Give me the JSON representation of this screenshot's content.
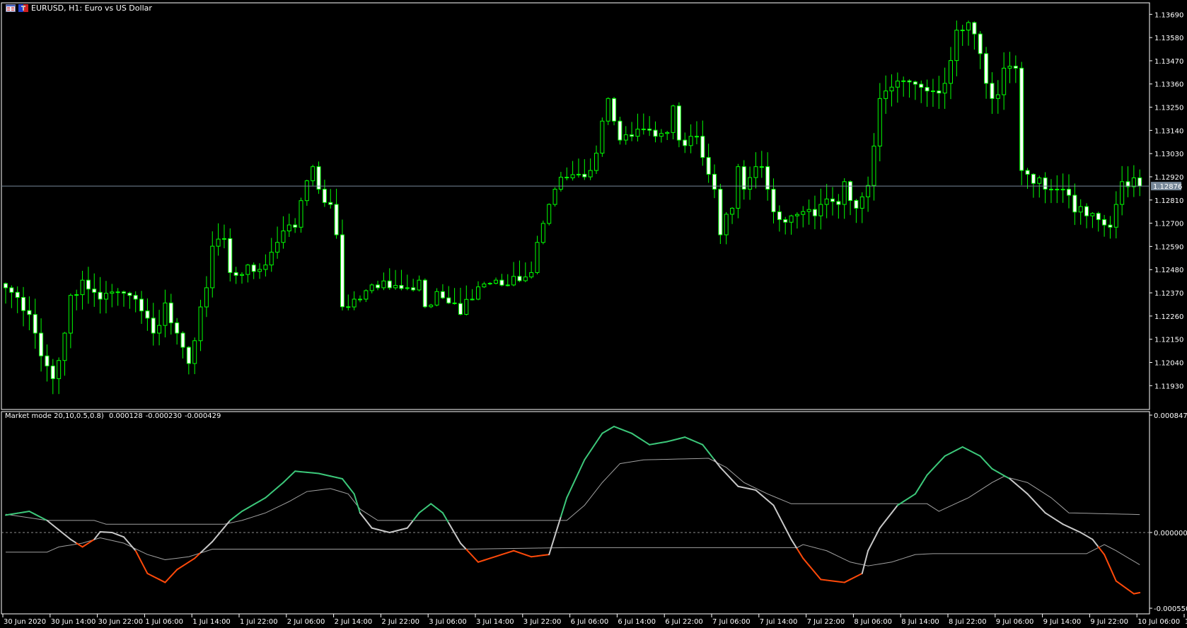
{
  "window": {
    "title": "EURUSD, H1:  Euro vs US Dollar",
    "icons": [
      "chart-window-icon",
      "symbol-icon"
    ]
  },
  "colors": {
    "background": "#000000",
    "candle_outline": "#00ff00",
    "bear_body": "#ffffff",
    "bull_body": "#000000",
    "current_price_line": "#778899",
    "axis": "#ffffff",
    "main_line_neutral": "#c8c8c8",
    "main_line_above": "#3cc87a",
    "main_line_below": "#ff4a0a",
    "bands": "#a0a0a0",
    "zero_line": "#8c8c8c"
  },
  "chart_data": [
    {
      "type": "candlestick",
      "title": "EURUSD, H1:  Euro vs US Dollar",
      "bar_count": 193,
      "ylim": [
        1.1168,
        1.1375
      ],
      "y_ticks": [
        "1.13690",
        "1.13580",
        "1.13470",
        "1.13360",
        "1.13250",
        "1.13140",
        "1.13030",
        "1.12920",
        "1.12810",
        "1.12700",
        "1.12590",
        "1.12480",
        "1.12370",
        "1.12260",
        "1.12150",
        "1.12040",
        "1.11930"
      ],
      "current_price": "1.12876",
      "close_keyframes": [
        [
          0,
          1.12394
        ],
        [
          3,
          1.12286
        ],
        [
          5,
          1.12179
        ],
        [
          6,
          1.12071
        ],
        [
          8,
          1.11963
        ],
        [
          10,
          1.12179
        ],
        [
          11,
          1.12358
        ],
        [
          13,
          1.1243
        ],
        [
          16,
          1.1234
        ],
        [
          22,
          1.1234
        ],
        [
          24,
          1.1225
        ],
        [
          25,
          1.12179
        ],
        [
          27,
          1.12322
        ],
        [
          29,
          1.12179
        ],
        [
          31,
          1.12035
        ],
        [
          32,
          1.12143
        ],
        [
          34,
          1.12394
        ],
        [
          35,
          1.12591
        ],
        [
          37,
          1.12627
        ],
        [
          38,
          1.12466
        ],
        [
          41,
          1.12502
        ],
        [
          44,
          1.12502
        ],
        [
          46,
          1.12609
        ],
        [
          49,
          1.12681
        ],
        [
          50,
          1.12807
        ],
        [
          52,
          1.12968
        ],
        [
          53,
          1.12861
        ],
        [
          55,
          1.12789
        ],
        [
          56,
          1.12645
        ],
        [
          57,
          1.12304
        ],
        [
          59,
          1.1234
        ],
        [
          60,
          1.1234
        ],
        [
          63,
          1.12394
        ],
        [
          65,
          1.12394
        ],
        [
          68,
          1.12394
        ],
        [
          70,
          1.1243
        ],
        [
          71,
          1.12304
        ],
        [
          73,
          1.12376
        ],
        [
          75,
          1.12322
        ],
        [
          77,
          1.12268
        ],
        [
          79,
          1.1234
        ],
        [
          81,
          1.12412
        ],
        [
          83,
          1.1243
        ],
        [
          86,
          1.12448
        ],
        [
          89,
          1.12466
        ],
        [
          90,
          1.12609
        ],
        [
          91,
          1.12699
        ],
        [
          92,
          1.12789
        ],
        [
          93,
          1.12861
        ],
        [
          95,
          1.12915
        ],
        [
          97,
          1.12932
        ],
        [
          99,
          1.1295
        ],
        [
          101,
          1.13184
        ],
        [
          102,
          1.13291
        ],
        [
          103,
          1.13184
        ],
        [
          104,
          1.13094
        ],
        [
          106,
          1.13112
        ],
        [
          110,
          1.13112
        ],
        [
          112,
          1.1313
        ],
        [
          113,
          1.13256
        ],
        [
          114,
          1.13094
        ],
        [
          116,
          1.13112
        ],
        [
          117,
          1.13112
        ],
        [
          119,
          1.12932
        ],
        [
          120,
          1.12861
        ],
        [
          121,
          1.12645
        ],
        [
          123,
          1.12771
        ],
        [
          124,
          1.12968
        ],
        [
          125,
          1.12861
        ],
        [
          127,
          1.12968
        ],
        [
          128,
          1.12968
        ],
        [
          129,
          1.12861
        ],
        [
          131,
          1.12717
        ],
        [
          133,
          1.12735
        ],
        [
          137,
          1.12735
        ],
        [
          138,
          1.12789
        ],
        [
          141,
          1.12789
        ],
        [
          142,
          1.12897
        ],
        [
          144,
          1.12771
        ],
        [
          145,
          1.12825
        ],
        [
          146,
          1.12879
        ],
        [
          148,
          1.13291
        ],
        [
          150,
          1.13345
        ],
        [
          157,
          1.13327
        ],
        [
          159,
          1.13363
        ],
        [
          160,
          1.13471
        ],
        [
          161,
          1.13615
        ],
        [
          163,
          1.13651
        ],
        [
          164,
          1.13597
        ],
        [
          166,
          1.13363
        ],
        [
          167,
          1.13291
        ],
        [
          168,
          1.13309
        ],
        [
          169,
          1.13435
        ],
        [
          171,
          1.13435
        ],
        [
          172,
          1.1295
        ],
        [
          173,
          1.12932
        ],
        [
          175,
          1.12915
        ],
        [
          177,
          1.12861
        ],
        [
          179,
          1.12861
        ],
        [
          181,
          1.12753
        ],
        [
          183,
          1.12735
        ],
        [
          185,
          1.12717
        ],
        [
          187,
          1.12681
        ],
        [
          188,
          1.12789
        ],
        [
          189,
          1.12897
        ],
        [
          191,
          1.12915
        ],
        [
          192,
          1.12876
        ]
      ],
      "x_ticks": [
        "30 Jun 2020",
        "30 Jun 14:00",
        "30 Jun 22:00",
        "1 Jul 06:00",
        "1 Jul 14:00",
        "1 Jul 22:00",
        "2 Jul 06:00",
        "2 Jul 14:00",
        "2 Jul 22:00",
        "3 Jul 06:00",
        "3 Jul 14:00",
        "3 Jul 22:00",
        "6 Jul 06:00",
        "6 Jul 14:00",
        "6 Jul 22:00",
        "7 Jul 06:00",
        "7 Jul 14:00",
        "7 Jul 22:00",
        "8 Jul 06:00",
        "8 Jul 14:00",
        "8 Jul 22:00",
        "9 Jul 06:00",
        "9 Jul 14:00",
        "9 Jul 22:00",
        "10 Jul 06:00",
        "10 Jul 14:00"
      ]
    },
    {
      "type": "line",
      "title": "Market mode 20,10,0.5,0.8)",
      "values_text": [
        "0.000128",
        "-0.000230",
        "-0.000429"
      ],
      "ylim": [
        -0.00055,
        0.000847
      ],
      "y_ticks": [
        "0.000847",
        "0.000000",
        "-0.000550"
      ],
      "unit_multiplier": 1e-06,
      "series": [
        {
          "name": "main",
          "keyframes": [
            [
              0,
              124
            ],
            [
              4,
              151
            ],
            [
              7,
              86
            ],
            [
              11,
              -49
            ],
            [
              13,
              -103
            ],
            [
              15,
              -49
            ],
            [
              16,
              5
            ],
            [
              18,
              0
            ],
            [
              20,
              -32
            ],
            [
              22,
              -130
            ],
            [
              24,
              -292
            ],
            [
              27,
              -356
            ],
            [
              29,
              -265
            ],
            [
              32,
              -184
            ],
            [
              35,
              -65
            ],
            [
              38,
              86
            ],
            [
              40,
              151
            ],
            [
              44,
              248
            ],
            [
              47,
              356
            ],
            [
              49,
              437
            ],
            [
              53,
              421
            ],
            [
              57,
              383
            ],
            [
              59,
              275
            ],
            [
              60,
              140
            ],
            [
              62,
              32
            ],
            [
              65,
              0
            ],
            [
              68,
              32
            ],
            [
              70,
              140
            ],
            [
              72,
              205
            ],
            [
              74,
              140
            ],
            [
              77,
              -76
            ],
            [
              80,
              -211
            ],
            [
              82,
              -184
            ],
            [
              86,
              -130
            ],
            [
              89,
              -173
            ],
            [
              92,
              -157
            ],
            [
              93,
              -22
            ],
            [
              95,
              248
            ],
            [
              98,
              518
            ],
            [
              101,
              707
            ],
            [
              103,
              756
            ],
            [
              106,
              707
            ],
            [
              109,
              626
            ],
            [
              112,
              648
            ],
            [
              115,
              680
            ],
            [
              118,
              626
            ],
            [
              121,
              464
            ],
            [
              124,
              329
            ],
            [
              127,
              302
            ],
            [
              130,
              194
            ],
            [
              133,
              -49
            ],
            [
              135,
              -184
            ],
            [
              138,
              -335
            ],
            [
              142,
              -356
            ],
            [
              145,
              -292
            ],
            [
              146,
              -130
            ],
            [
              148,
              32
            ],
            [
              151,
              194
            ],
            [
              154,
              275
            ],
            [
              156,
              410
            ],
            [
              159,
              545
            ],
            [
              162,
              610
            ],
            [
              165,
              545
            ],
            [
              167,
              454
            ],
            [
              170,
              383
            ],
            [
              173,
              275
            ],
            [
              176,
              140
            ],
            [
              179,
              59
            ],
            [
              182,
              0
            ],
            [
              184,
              -49
            ],
            [
              186,
              -157
            ],
            [
              188,
              -346
            ],
            [
              191,
              -437
            ],
            [
              192,
              -429
            ]
          ]
        },
        {
          "name": "upper",
          "keyframes": [
            [
              0,
              130
            ],
            [
              7,
              86
            ],
            [
              15,
              86
            ],
            [
              17,
              59
            ],
            [
              37,
              59
            ],
            [
              40,
              86
            ],
            [
              44,
              140
            ],
            [
              48,
              221
            ],
            [
              51,
              292
            ],
            [
              55,
              313
            ],
            [
              58,
              275
            ],
            [
              60,
              167
            ],
            [
              63,
              86
            ],
            [
              95,
              86
            ],
            [
              98,
              194
            ],
            [
              101,
              356
            ],
            [
              104,
              491
            ],
            [
              108,
              518
            ],
            [
              119,
              529
            ],
            [
              122,
              464
            ],
            [
              125,
              356
            ],
            [
              129,
              275
            ],
            [
              133,
              205
            ],
            [
              156,
              205
            ],
            [
              158,
              151
            ],
            [
              163,
              248
            ],
            [
              167,
              356
            ],
            [
              169,
              400
            ],
            [
              173,
              356
            ],
            [
              177,
              248
            ],
            [
              180,
              140
            ],
            [
              192,
              128
            ]
          ]
        },
        {
          "name": "lower",
          "keyframes": [
            [
              0,
              -140
            ],
            [
              7,
              -140
            ],
            [
              9,
              -103
            ],
            [
              13,
              -76
            ],
            [
              16,
              -38
            ],
            [
              20,
              -76
            ],
            [
              24,
              -157
            ],
            [
              27,
              -194
            ],
            [
              31,
              -173
            ],
            [
              35,
              -119
            ],
            [
              77,
              -119
            ],
            [
              95,
              -108
            ],
            [
              134,
              -108
            ],
            [
              135,
              -86
            ],
            [
              139,
              -130
            ],
            [
              143,
              -211
            ],
            [
              146,
              -238
            ],
            [
              150,
              -211
            ],
            [
              154,
              -157
            ],
            [
              157,
              -151
            ],
            [
              183,
              -151
            ],
            [
              186,
              -86
            ],
            [
              188,
              -130
            ],
            [
              192,
              -230
            ]
          ]
        }
      ]
    }
  ]
}
